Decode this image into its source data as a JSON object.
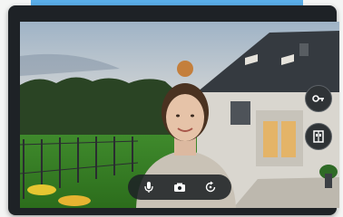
{
  "colors": {
    "bezel": "#1e2226",
    "accent_blue": "#5aaee8",
    "control_bg": "#1e2226",
    "icon": "#ffffff"
  },
  "side_buttons": [
    {
      "icon": "key-icon"
    },
    {
      "icon": "door-icon"
    }
  ],
  "controls": [
    {
      "icon": "microphone-icon"
    },
    {
      "icon": "camera-icon"
    },
    {
      "icon": "rotate-icon"
    }
  ]
}
